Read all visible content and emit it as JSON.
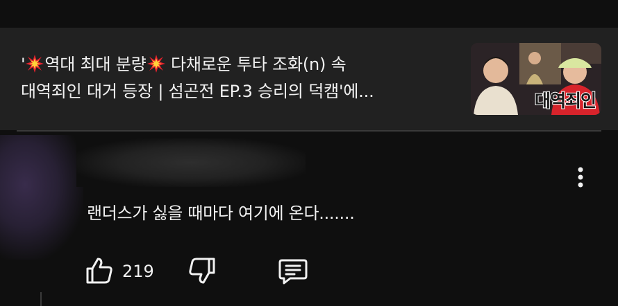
{
  "video_card": {
    "title_line1_prefix": "'",
    "title_line1_a": "역대 최대 분량",
    "title_line1_b": " 다채로운 투타 조화(n) 속",
    "title_line2": "대역죄인 대거 등장 | 섬곤전 EP.3 승리의 덕캠'에...",
    "title_icon": "collision-emoji-icon",
    "thumbnail_text": "대역죄인"
  },
  "comment": {
    "text": "랜더스가 싫을 때마다 여기에 온다.......",
    "like_count": "219",
    "icons": {
      "more": "more-vert-icon",
      "like": "thumb-up-icon",
      "dislike": "thumb-down-icon",
      "reply": "comment-reply-icon"
    }
  },
  "colors": {
    "background": "#0f0f0f",
    "card_background": "#212121",
    "text": "#f1f1f1",
    "burst_red": "#e8212e",
    "burst_yellow": "#ffd23a"
  }
}
